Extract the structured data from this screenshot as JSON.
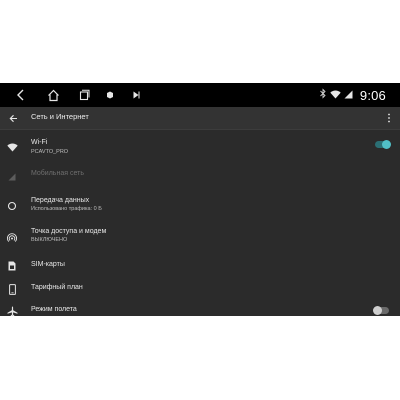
{
  "status": {
    "time": "9:06",
    "icons": [
      "bluetooth-icon",
      "wifi-icon",
      "signal-icon"
    ]
  },
  "navbar": {
    "buttons": [
      "back-icon",
      "home-icon",
      "recents-icon",
      "record-icon",
      "media-icon"
    ]
  },
  "appbar": {
    "title": "Сеть и Интернет"
  },
  "items": [
    {
      "title": "Wi-Fi",
      "subtitle": "PCAVTO_PRO",
      "icon": "wifi-icon",
      "toggle": true
    },
    {
      "title": "Мобильная сеть",
      "icon": "signal-icon",
      "disabled": true
    },
    {
      "title": "Передача данных",
      "subtitle": "Использовано трафика: 0 Б",
      "icon": "data-usage-icon"
    },
    {
      "title": "Точка доступа и модем",
      "subtitle": "ВЫКЛЮЧЕНО",
      "icon": "hotspot-icon"
    },
    {
      "title": "SIM-карты",
      "icon": "sim-card-icon"
    },
    {
      "title": "Тарифный план",
      "icon": "phone-icon"
    },
    {
      "title": "Режим полета",
      "icon": "airplane-icon",
      "toggle": false
    }
  ],
  "colors": {
    "background": "#2b2b2b",
    "accent": "#51c0c7",
    "statusbar": "#000000"
  }
}
